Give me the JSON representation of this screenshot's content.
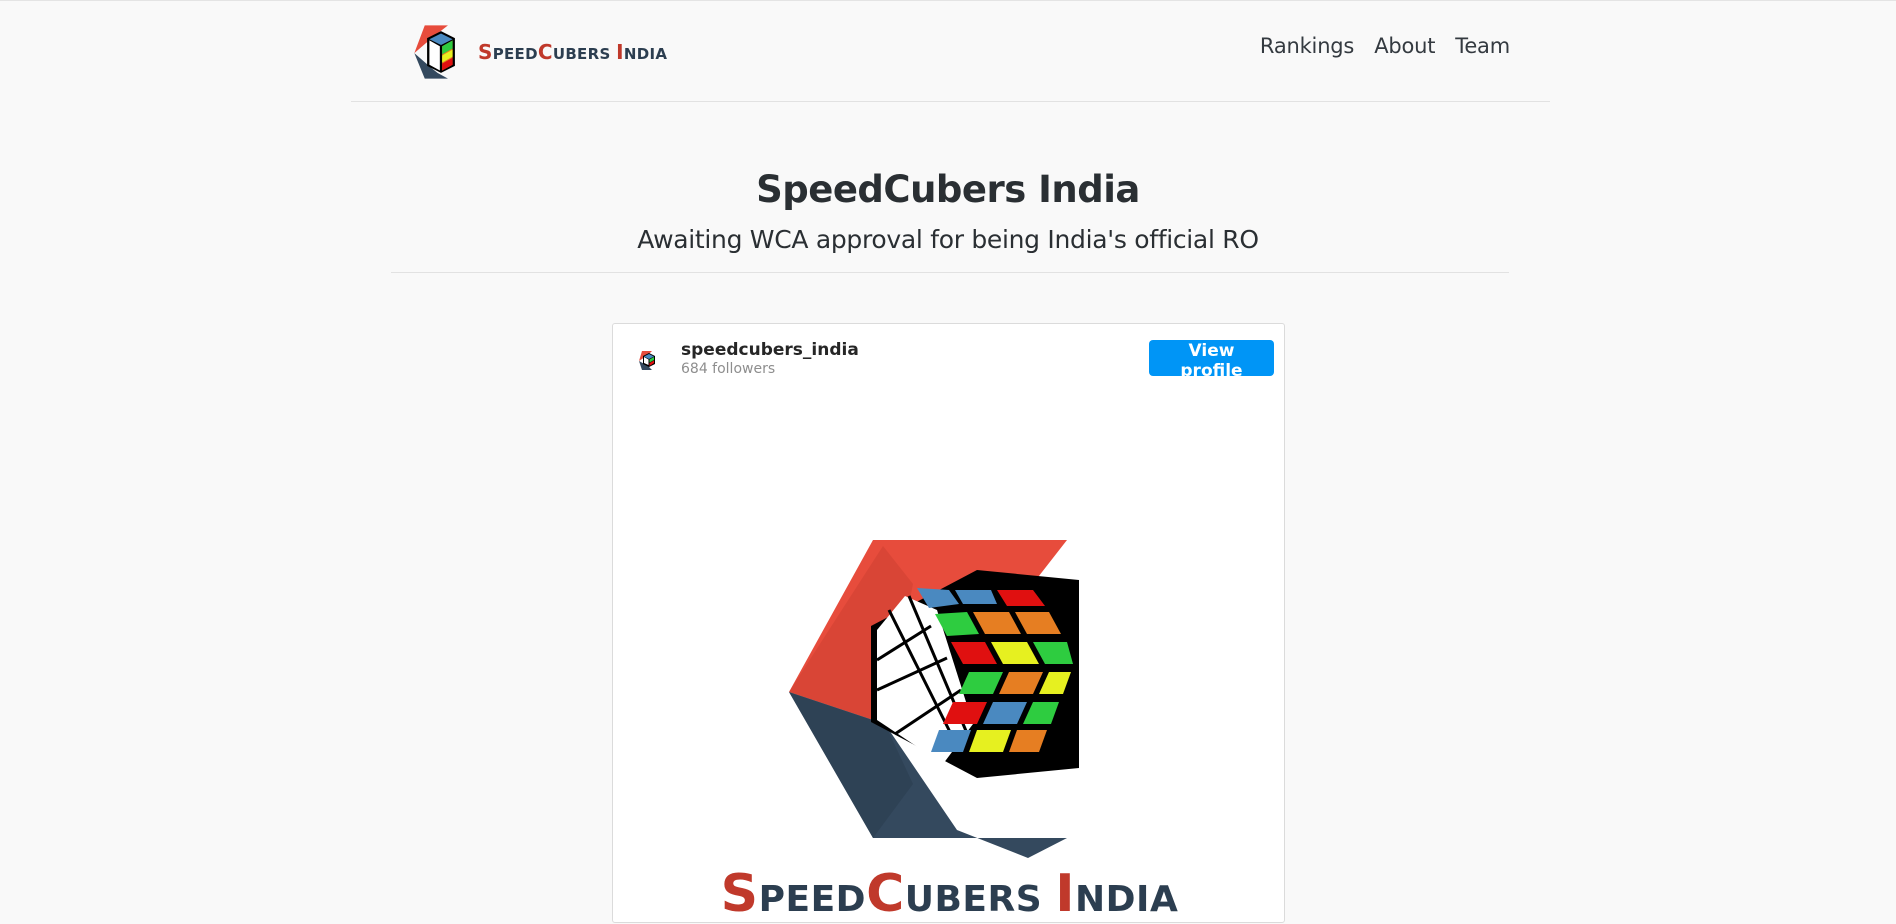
{
  "brand": {
    "parts": [
      {
        "cap": "S",
        "rest": "PEED"
      },
      {
        "cap": "C",
        "rest": "UBERS "
      },
      {
        "cap": "I",
        "rest": "NDIA"
      }
    ],
    "colors": {
      "accent": "#c0392b",
      "dark": "#2c3e50"
    }
  },
  "nav": {
    "items": [
      "Rankings",
      "About",
      "Team"
    ]
  },
  "hero": {
    "title": "SpeedCubers India",
    "subtitle": "Awaiting WCA approval for being India's official RO"
  },
  "instagram": {
    "username": "speedcubers_india",
    "followers": "684 followers",
    "view_profile_label": "View profile",
    "button_color": "#0095f6",
    "post_logo_text": {
      "parts": [
        {
          "cap": "S",
          "rest": "PEED"
        },
        {
          "cap": "C",
          "rest": "UBERS "
        },
        {
          "cap": "I",
          "rest": "NDIA"
        }
      ]
    }
  }
}
